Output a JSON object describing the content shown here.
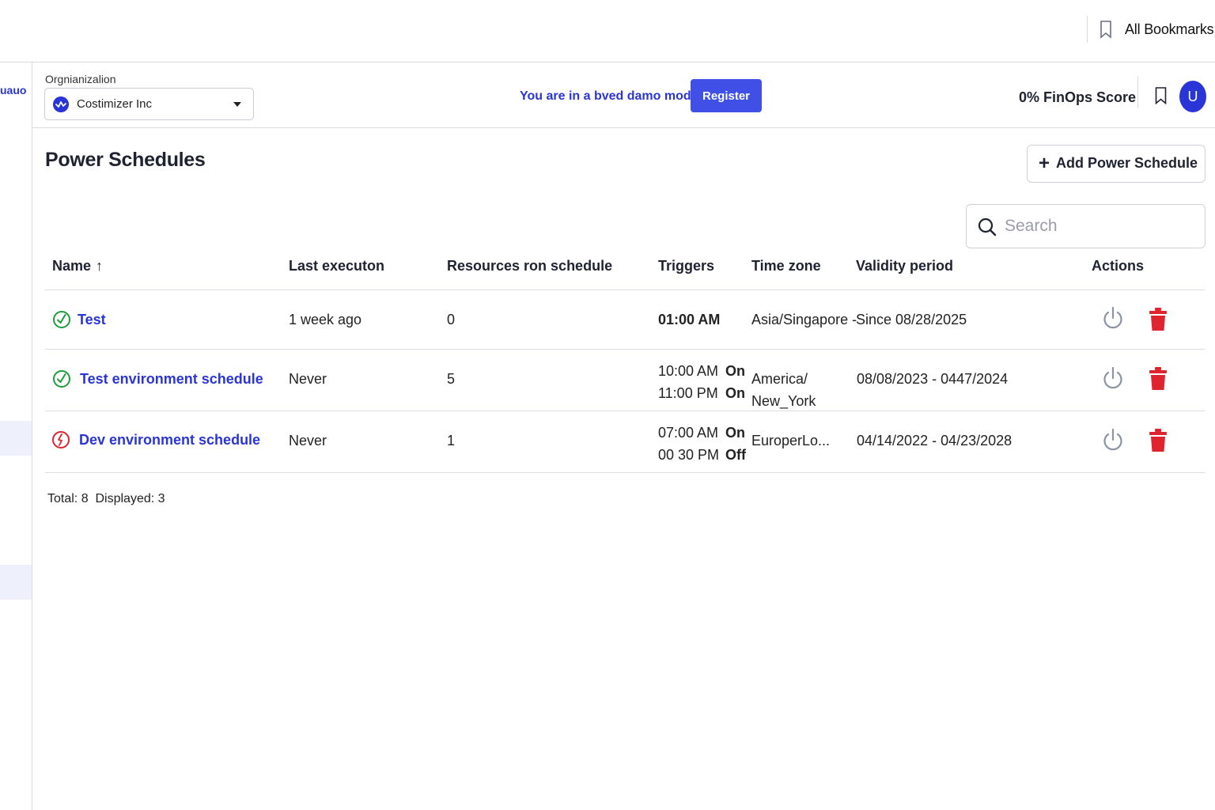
{
  "browser": {
    "bookmarks_label": "All Bookmarks"
  },
  "rail": {
    "link_text": "uauo"
  },
  "header": {
    "org_label": "Orgnianizalion",
    "org_name": "Costimizer Inc",
    "demo_text": "You are in a bved damo mode",
    "register_label": "Register",
    "finops_score": "0% FinOps Score",
    "avatar_letter": "U"
  },
  "page": {
    "title": "Power Schedules",
    "add_label": "Add Power Schedule",
    "search_placeholder": "Search"
  },
  "table": {
    "headers": {
      "name": "Name",
      "last_execution": "Last executon",
      "resources": "Resources ron schedule",
      "triggers": "Triggers",
      "time_zone": "Time zone",
      "validity": "Validity period",
      "actions": "Actions"
    },
    "rows": [
      {
        "status": "active",
        "name": "Test",
        "last_execution": "1 week ago",
        "resources": "0",
        "trigger1_time": "01:00 AM",
        "trigger1_state": "",
        "trigger2_time": "",
        "trigger2_state": "",
        "tz_line1": "Asia/Singapore -",
        "tz_line2": "",
        "validity": "Since 08/28/2025"
      },
      {
        "status": "active",
        "name": "Test environment schedule",
        "last_execution": "Never",
        "resources": "5",
        "trigger1_time": "10:00 AM",
        "trigger1_state": "On",
        "trigger2_time": "11:00 PM",
        "trigger2_state": "On",
        "tz_line1": "America/",
        "tz_line2": "New_York",
        "validity": "08/08/2023 - 0447/2024"
      },
      {
        "status": "error",
        "name": "Dev environment schedule",
        "last_execution": "Never",
        "resources": "1",
        "trigger1_time": "07:00 AM",
        "trigger1_state": "On",
        "trigger2_time": "00 30 PM",
        "trigger2_state": "Off",
        "tz_line1": "EuroperLo...",
        "tz_line2": "",
        "validity": "04/14/2022 - 04/23/2028"
      }
    ]
  },
  "footer": {
    "total_label": "Total: 8",
    "displayed_label": "Displayed: 3"
  },
  "colors": {
    "accent": "#2a35d8",
    "button": "#4050e6",
    "success": "#1f9d3a",
    "error": "#e0242f",
    "delete": "#e0242f",
    "icon_gray": "#8a94a6"
  }
}
